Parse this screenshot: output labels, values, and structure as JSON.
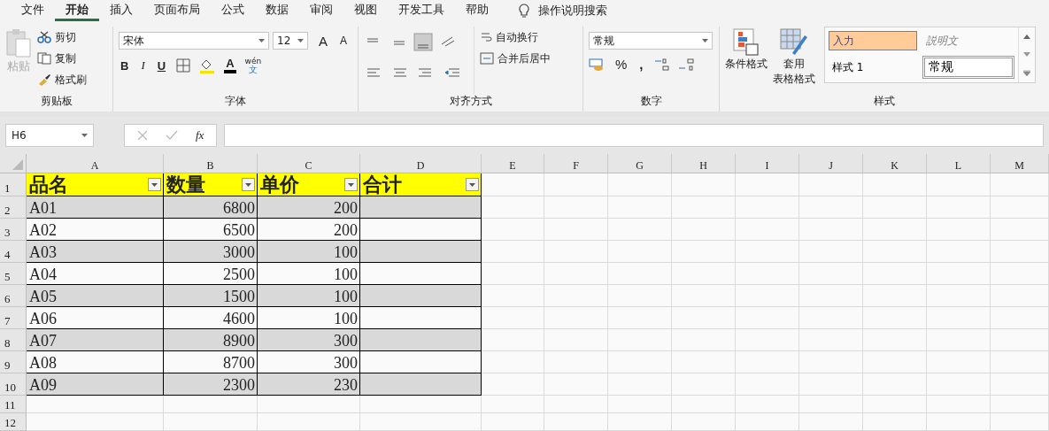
{
  "tabs": [
    {
      "label": "文件",
      "selected": false
    },
    {
      "label": "开始",
      "selected": true
    },
    {
      "label": "插入",
      "selected": false
    },
    {
      "label": "页面布局",
      "selected": false
    },
    {
      "label": "公式",
      "selected": false
    },
    {
      "label": "数据",
      "selected": false
    },
    {
      "label": "审阅",
      "selected": false
    },
    {
      "label": "视图",
      "selected": false
    },
    {
      "label": "开发工具",
      "selected": false
    },
    {
      "label": "帮助",
      "selected": false
    }
  ],
  "search": {
    "label": "操作说明搜索"
  },
  "clipboard": {
    "paste": "粘贴",
    "cut": "剪切",
    "copy": "复制",
    "painter": "格式刷",
    "title": "剪贴板"
  },
  "font": {
    "name": "宋体",
    "size": "12",
    "grow": "A",
    "shrink": "A",
    "bold": "B",
    "italic": "I",
    "underline": "U",
    "font_color": "A",
    "phonetic_top": "wén",
    "phonetic_bottom": "文",
    "title": "字体"
  },
  "alignment": {
    "wrap": "自动换行",
    "merge": "合并后居中",
    "title": "对齐方式"
  },
  "number": {
    "format": "常规",
    "percent": "%",
    "comma": ",",
    "title": "数字"
  },
  "styles": {
    "conditional": "条件格式",
    "table_top": "套用",
    "table_bottom": "表格格式",
    "title": "样式",
    "cells": [
      {
        "label": "入力",
        "kind": "input",
        "selected": false
      },
      {
        "label": "説明文",
        "kind": "note",
        "selected": false
      },
      {
        "label": "样式 1",
        "kind": "plain",
        "selected": false
      },
      {
        "label": "常规",
        "kind": "normal",
        "selected": true
      }
    ]
  },
  "formula_bar": {
    "name_box": "H6",
    "fx": "fx"
  },
  "sheet": {
    "columns": [
      "A",
      "B",
      "C",
      "D",
      "E",
      "F",
      "G",
      "H",
      "I",
      "J",
      "K",
      "L",
      "M"
    ],
    "rows": [
      {
        "number": "1",
        "header": true,
        "shaded": false,
        "cells": [
          "品名",
          "数量",
          "单价",
          "合计"
        ]
      },
      {
        "number": "2",
        "header": false,
        "shaded": true,
        "cells": [
          "A01",
          "6800",
          "200"
        ]
      },
      {
        "number": "3",
        "header": false,
        "shaded": false,
        "cells": [
          "A02",
          "6500",
          "200"
        ]
      },
      {
        "number": "4",
        "header": false,
        "shaded": true,
        "cells": [
          "A03",
          "3000",
          "100"
        ]
      },
      {
        "number": "5",
        "header": false,
        "shaded": false,
        "cells": [
          "A04",
          "2500",
          "100"
        ]
      },
      {
        "number": "6",
        "header": false,
        "shaded": true,
        "cells": [
          "A05",
          "1500",
          "100"
        ]
      },
      {
        "number": "7",
        "header": false,
        "shaded": false,
        "cells": [
          "A06",
          "4600",
          "100"
        ]
      },
      {
        "number": "8",
        "header": false,
        "shaded": true,
        "cells": [
          "A07",
          "8900",
          "300"
        ]
      },
      {
        "number": "9",
        "header": false,
        "shaded": false,
        "cells": [
          "A08",
          "8700",
          "300"
        ]
      },
      {
        "number": "10",
        "header": false,
        "shaded": true,
        "cells": [
          "A09",
          "2300",
          "230"
        ]
      },
      {
        "number": "11",
        "header": false,
        "shaded": false,
        "cells": []
      },
      {
        "number": "12",
        "header": false,
        "shaded": false,
        "cells": []
      }
    ]
  }
}
